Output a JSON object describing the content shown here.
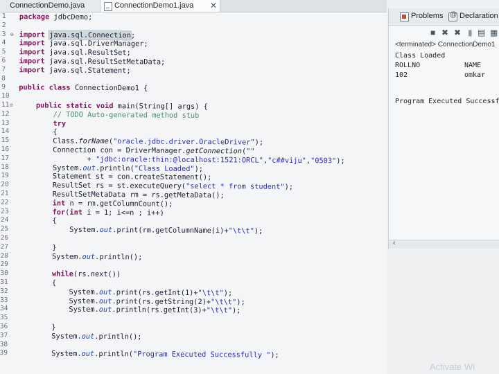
{
  "editor": {
    "tabs": [
      {
        "label": "ConnectionDemo.java"
      },
      {
        "label": "ConnectionDemo1.java"
      }
    ],
    "close_glyph": "✕",
    "lines": [
      {
        "n": "1",
        "code": [
          {
            "t": "package",
            "c": "kw"
          },
          {
            "t": " jdbcDemo;"
          }
        ]
      },
      {
        "n": "2",
        "code": []
      },
      {
        "n": "3",
        "fold": "⊖",
        "code": [
          {
            "t": "import",
            "c": "kw"
          },
          {
            "t": " "
          },
          {
            "t": "java.sql.Connection",
            "c": "sel"
          },
          {
            "t": ";"
          }
        ]
      },
      {
        "n": "4",
        "code": [
          {
            "t": "import",
            "c": "kw"
          },
          {
            "t": " java.sql.DriverManager;"
          }
        ]
      },
      {
        "n": "5",
        "code": [
          {
            "t": "import",
            "c": "kw"
          },
          {
            "t": " java.sql.ResultSet;"
          }
        ]
      },
      {
        "n": "6",
        "code": [
          {
            "t": "import",
            "c": "kw"
          },
          {
            "t": " java.sql.ResultSetMetaData;"
          }
        ]
      },
      {
        "n": "7",
        "code": [
          {
            "t": "import",
            "c": "kw"
          },
          {
            "t": " java.sql.Statement;"
          }
        ]
      },
      {
        "n": "8",
        "code": []
      },
      {
        "n": "9",
        "code": [
          {
            "t": "public class",
            "c": "kw"
          },
          {
            "t": " ConnectionDemo1 {"
          }
        ]
      },
      {
        "n": "10",
        "code": []
      },
      {
        "n": "11",
        "fold": "⊖",
        "code": [
          {
            "t": "    "
          },
          {
            "t": "public static void",
            "c": "kw"
          },
          {
            "t": " main(String[] args) {"
          }
        ]
      },
      {
        "n": "12",
        "code": [
          {
            "t": "        "
          },
          {
            "t": "// TODO Auto-generated method stub",
            "c": "cm"
          }
        ]
      },
      {
        "n": "13",
        "code": [
          {
            "t": "        "
          },
          {
            "t": "try",
            "c": "kw"
          }
        ]
      },
      {
        "n": "14",
        "code": [
          {
            "t": "        {"
          }
        ]
      },
      {
        "n": "15",
        "code": [
          {
            "t": "        Class."
          },
          {
            "t": "forName",
            "c": "it"
          },
          {
            "t": "("
          },
          {
            "t": "\"oracle.jdbc.driver.OracleDriver\"",
            "c": "str"
          },
          {
            "t": ");"
          }
        ]
      },
      {
        "n": "16",
        "code": [
          {
            "t": "        Connection con = DriverManager."
          },
          {
            "t": "getConnection",
            "c": "it"
          },
          {
            "t": "("
          },
          {
            "t": "\"\"",
            "c": "str"
          }
        ]
      },
      {
        "n": "17",
        "code": [
          {
            "t": "                + "
          },
          {
            "t": "\"jdbc:oracle:thin:@localhost:1521:ORCL\"",
            "c": "str"
          },
          {
            "t": ","
          },
          {
            "t": "\"c##viju\"",
            "c": "str"
          },
          {
            "t": ","
          },
          {
            "t": "\"0503\"",
            "c": "str"
          },
          {
            "t": ");"
          }
        ]
      },
      {
        "n": "18",
        "code": [
          {
            "t": "        System."
          },
          {
            "t": "out",
            "c": "fld"
          },
          {
            "t": ".println("
          },
          {
            "t": "\"Class Loaded\"",
            "c": "str"
          },
          {
            "t": ");"
          }
        ]
      },
      {
        "n": "19",
        "code": [
          {
            "t": "        Statement st = con.createStatement();"
          }
        ]
      },
      {
        "n": "20",
        "code": [
          {
            "t": "        ResultSet rs = st.executeQuery("
          },
          {
            "t": "\"select * from student\"",
            "c": "str"
          },
          {
            "t": ");"
          }
        ]
      },
      {
        "n": "21",
        "code": [
          {
            "t": "        ResultSetMetaData rm = rs.getMetaData();"
          }
        ]
      },
      {
        "n": "22",
        "code": [
          {
            "t": "        "
          },
          {
            "t": "int",
            "c": "kw"
          },
          {
            "t": " n = rm.getColumnCount();"
          }
        ]
      },
      {
        "n": "23",
        "code": [
          {
            "t": "        "
          },
          {
            "t": "for",
            "c": "kw"
          },
          {
            "t": "("
          },
          {
            "t": "int",
            "c": "kw"
          },
          {
            "t": " i = 1; i<=n ; i++)"
          }
        ]
      },
      {
        "n": "24",
        "code": [
          {
            "t": "        {"
          }
        ]
      },
      {
        "n": "25",
        "code": [
          {
            "t": "            System."
          },
          {
            "t": "out",
            "c": "fld"
          },
          {
            "t": ".print(rm.getColumnName(i)+"
          },
          {
            "t": "\"\\t\\t\"",
            "c": "str"
          },
          {
            "t": ");"
          }
        ]
      },
      {
        "n": "26",
        "code": []
      },
      {
        "n": "27",
        "code": [
          {
            "t": "        }"
          }
        ]
      },
      {
        "n": "28",
        "code": [
          {
            "t": "        System."
          },
          {
            "t": "out",
            "c": "fld"
          },
          {
            "t": ".println();"
          }
        ]
      },
      {
        "n": "29",
        "code": []
      },
      {
        "n": "30",
        "code": [
          {
            "t": "        "
          },
          {
            "t": "while",
            "c": "kw"
          },
          {
            "t": "(rs.next())"
          }
        ]
      },
      {
        "n": "31",
        "code": [
          {
            "t": "        {"
          }
        ]
      },
      {
        "n": "32",
        "code": [
          {
            "t": "            System."
          },
          {
            "t": "out",
            "c": "fld"
          },
          {
            "t": ".print(rs.getInt(1)+"
          },
          {
            "t": "\"\\t\\t\"",
            "c": "str"
          },
          {
            "t": ");"
          }
        ]
      },
      {
        "n": "33",
        "code": [
          {
            "t": "            System."
          },
          {
            "t": "out",
            "c": "fld"
          },
          {
            "t": ".print(rs.getString(2)+"
          },
          {
            "t": "\"\\t\\t\"",
            "c": "str"
          },
          {
            "t": ");"
          }
        ]
      },
      {
        "n": "34",
        "code": [
          {
            "t": "            System."
          },
          {
            "t": "out",
            "c": "fld"
          },
          {
            "t": ".println(rs.getInt(3)+"
          },
          {
            "t": "\"\\t\\t\"",
            "c": "str"
          },
          {
            "t": ");"
          }
        ]
      },
      {
        "n": "35",
        "code": []
      },
      {
        "n": "36",
        "code": [
          {
            "t": "        }"
          }
        ]
      },
      {
        "n": "37",
        "code": [
          {
            "t": "        System."
          },
          {
            "t": "out",
            "c": "fld"
          },
          {
            "t": ".println();"
          }
        ]
      },
      {
        "n": "38",
        "code": []
      },
      {
        "n": "39",
        "code": [
          {
            "t": "        System."
          },
          {
            "t": "out",
            "c": "fld"
          },
          {
            "t": ".println("
          },
          {
            "t": "\"Program Executed Successfully \"",
            "c": "str"
          },
          {
            "t": ");"
          }
        ]
      }
    ]
  },
  "panel": {
    "tabs": {
      "problems": "Problems",
      "declaration": "Declaration"
    },
    "toolbar_icons": [
      "terminate-icon",
      "remove-launch-icon",
      "remove-all-icon",
      "scroll-lock-icon",
      "pin-console-icon",
      "clear-console-icon"
    ],
    "console": {
      "status": "<terminated> ConnectionDemo1",
      "output": [
        [
          "Class Loaded"
        ],
        [
          "ROLLNO",
          "NAME"
        ],
        [
          "102",
          "omkar"
        ],
        [],
        [
          "Program Executed Successfully"
        ]
      ]
    }
  },
  "watermark": "Activate Wi"
}
